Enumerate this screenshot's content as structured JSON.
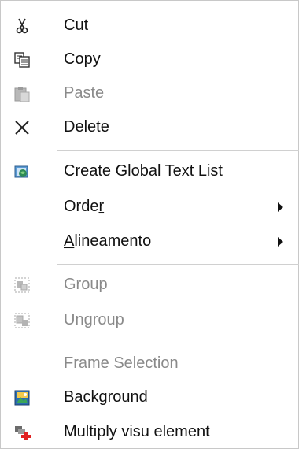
{
  "menu": {
    "items": [
      {
        "label": "Cut",
        "icon": "scissors-icon",
        "enabled": true
      },
      {
        "label": "Copy",
        "icon": "copy-icon",
        "enabled": true
      },
      {
        "label": "Paste",
        "icon": "paste-icon",
        "enabled": false
      },
      {
        "label": "Delete",
        "icon": "delete-x-icon",
        "enabled": true
      },
      {
        "label": "Create Global Text List",
        "icon": "global-text-list-icon",
        "enabled": true
      },
      {
        "label_pre": "Orde",
        "label_ul": "r",
        "label_post": "",
        "submenu": true,
        "enabled": true
      },
      {
        "label_pre": "",
        "label_ul": "A",
        "label_post": "lineamento",
        "submenu": true,
        "enabled": true
      },
      {
        "label": "Group",
        "icon": "group-icon",
        "enabled": false
      },
      {
        "label": "Ungroup",
        "icon": "ungroup-icon",
        "enabled": false
      },
      {
        "label": "Frame Selection",
        "enabled": false
      },
      {
        "label": "Background",
        "icon": "background-image-icon",
        "enabled": true
      },
      {
        "label": "Multiply visu element",
        "icon": "multiply-element-icon",
        "enabled": true
      }
    ]
  },
  "colors": {
    "text": "#111111",
    "disabled_text": "#8a8a8a",
    "separator": "#d0d0d0",
    "accent_red": "#e02020"
  }
}
